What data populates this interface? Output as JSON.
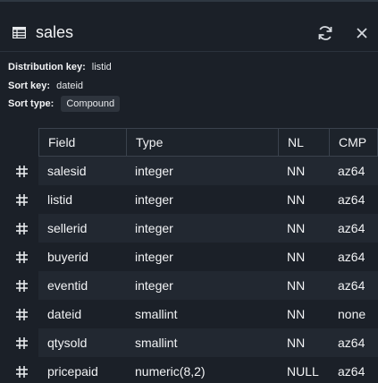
{
  "header": {
    "title": "sales",
    "icon": "table-icon",
    "refresh_icon": "refresh-icon",
    "close_icon": "close-icon"
  },
  "meta": {
    "distribution_key_label": "Distribution key:",
    "distribution_key_value": "listid",
    "sort_key_label": "Sort key:",
    "sort_key_value": "dateid",
    "sort_type_label": "Sort type:",
    "sort_type_value": "Compound"
  },
  "columns": {
    "field": "Field",
    "type": "Type",
    "nl": "NL",
    "cmp": "CMP"
  },
  "rows": [
    {
      "field": "salesid",
      "type": "integer",
      "nl": "NN",
      "cmp": "az64"
    },
    {
      "field": "listid",
      "type": "integer",
      "nl": "NN",
      "cmp": "az64"
    },
    {
      "field": "sellerid",
      "type": "integer",
      "nl": "NN",
      "cmp": "az64"
    },
    {
      "field": "buyerid",
      "type": "integer",
      "nl": "NN",
      "cmp": "az64"
    },
    {
      "field": "eventid",
      "type": "integer",
      "nl": "NN",
      "cmp": "az64"
    },
    {
      "field": "dateid",
      "type": "smallint",
      "nl": "NN",
      "cmp": "none"
    },
    {
      "field": "qtysold",
      "type": "smallint",
      "nl": "NN",
      "cmp": "az64"
    },
    {
      "field": "pricepaid",
      "type": "numeric(8,2)",
      "nl": "NULL",
      "cmp": "az64"
    }
  ]
}
